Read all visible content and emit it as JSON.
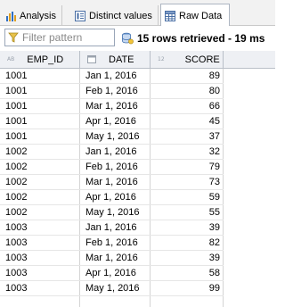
{
  "tabs": [
    {
      "label": "Analysis",
      "icon": "bar-chart-icon",
      "active": false
    },
    {
      "label": "Distinct values",
      "icon": "distinct-values-icon",
      "active": false
    },
    {
      "label": "Raw Data",
      "icon": "table-icon",
      "active": true
    }
  ],
  "filter": {
    "placeholder": "Filter pattern",
    "value": ""
  },
  "status": {
    "text": "15 rows retrieved - 19 ms"
  },
  "columns": [
    {
      "label": "EMP_ID",
      "type_tag": "AB"
    },
    {
      "label": "DATE",
      "type_tag": "calendar"
    },
    {
      "label": "SCORE",
      "type_tag": "12"
    }
  ],
  "rows": [
    {
      "emp_id": "1001",
      "date": "Jan 1, 2016",
      "score": "89"
    },
    {
      "emp_id": "1001",
      "date": "Feb 1, 2016",
      "score": "80"
    },
    {
      "emp_id": "1001",
      "date": "Mar 1, 2016",
      "score": "66"
    },
    {
      "emp_id": "1001",
      "date": "Apr 1, 2016",
      "score": "45"
    },
    {
      "emp_id": "1001",
      "date": "May 1, 2016",
      "score": "37"
    },
    {
      "emp_id": "1002",
      "date": "Jan 1, 2016",
      "score": "32"
    },
    {
      "emp_id": "1002",
      "date": "Feb 1, 2016",
      "score": "79"
    },
    {
      "emp_id": "1002",
      "date": "Mar 1, 2016",
      "score": "73"
    },
    {
      "emp_id": "1002",
      "date": "Apr 1, 2016",
      "score": "59"
    },
    {
      "emp_id": "1002",
      "date": "May 1, 2016",
      "score": "55"
    },
    {
      "emp_id": "1003",
      "date": "Jan 1, 2016",
      "score": "39"
    },
    {
      "emp_id": "1003",
      "date": "Feb 1, 2016",
      "score": "82"
    },
    {
      "emp_id": "1003",
      "date": "Mar 1, 2016",
      "score": "39"
    },
    {
      "emp_id": "1003",
      "date": "Apr 1, 2016",
      "score": "58"
    },
    {
      "emp_id": "1003",
      "date": "May 1, 2016",
      "score": "99"
    }
  ]
}
